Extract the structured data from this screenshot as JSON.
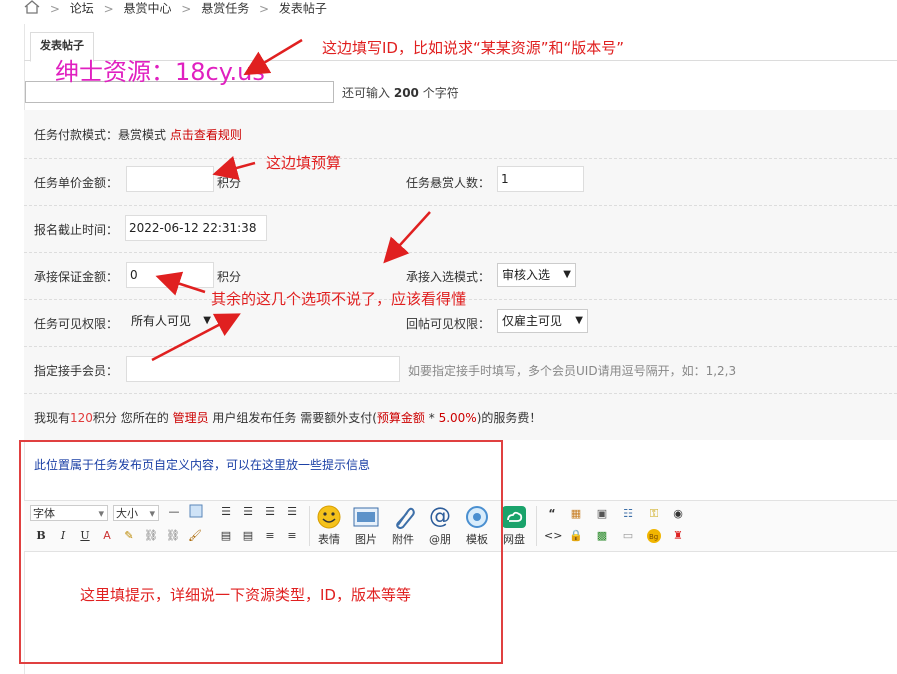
{
  "breadcrumb": {
    "items": [
      "论坛",
      "悬赏中心",
      "悬赏任务",
      "发表帖子"
    ]
  },
  "tab": {
    "label": "发表帖子"
  },
  "watermark": "绅士资源：18cy.us",
  "subject": {
    "value": "",
    "remain_prefix": "还可输入",
    "remain_count": "200",
    "remain_suffix": "个字符"
  },
  "form": {
    "pay_mode_label": "任务付款模式：",
    "pay_mode_value": "悬赏模式",
    "pay_mode_link": "点击查看规则",
    "unit_price_label": "任务单价金额：",
    "unit_price_value": "",
    "unit_price_unit": "积分",
    "reward_count_label": "任务悬赏人数：",
    "reward_count_value": "1",
    "deadline_label": "报名截止时间：",
    "deadline_value": "2022-06-12 22:31:38",
    "deposit_label": "承接保证金额：",
    "deposit_value": "0",
    "deposit_unit": "积分",
    "accept_mode_label": "承接入选模式：",
    "accept_mode_value": "审核入选",
    "visible_label": "任务可见权限：",
    "visible_value": "所有人可见",
    "reply_visible_label": "回帖可见权限：",
    "reply_visible_value": "仅雇主可见",
    "assign_label": "指定接手会员：",
    "assign_value": "",
    "assign_hint": "如要指定接手时填写，多个会员UID请用逗号隔开，如：1,2,3",
    "fee_p1": "我现有",
    "fee_points": "120",
    "fee_p2": "积分 您所在的",
    "fee_group": "管理员",
    "fee_p3": "用户组发布任务 需要额外支付(",
    "fee_budget": "预算金额",
    "fee_p4": " * ",
    "fee_rate": "5.00%",
    "fee_p5": ")的服务费！"
  },
  "custom_notice": "此位置属于任务发布页自定义内容，可以在这里放一些提示信息",
  "editor": {
    "font_select": "字体",
    "size_select": "大小",
    "buttons": [
      "表情",
      "图片",
      "附件",
      "@朋",
      "模板",
      "网盘"
    ],
    "small_row2": [
      "B",
      "I",
      "U"
    ]
  },
  "annotations": {
    "a1": "这边填写ID，比如说求“某某资源”和“版本号”",
    "a2": "这边填预算",
    "a3": "其余的这几个选项不说了，应该看得懂",
    "a4": "这里填提示，详细说一下资源类型，ID，版本等等"
  },
  "colors": {
    "annotation": "#e02020",
    "watermark": "#e020c0",
    "link": "#c00",
    "notice": "#1a3fa5"
  }
}
